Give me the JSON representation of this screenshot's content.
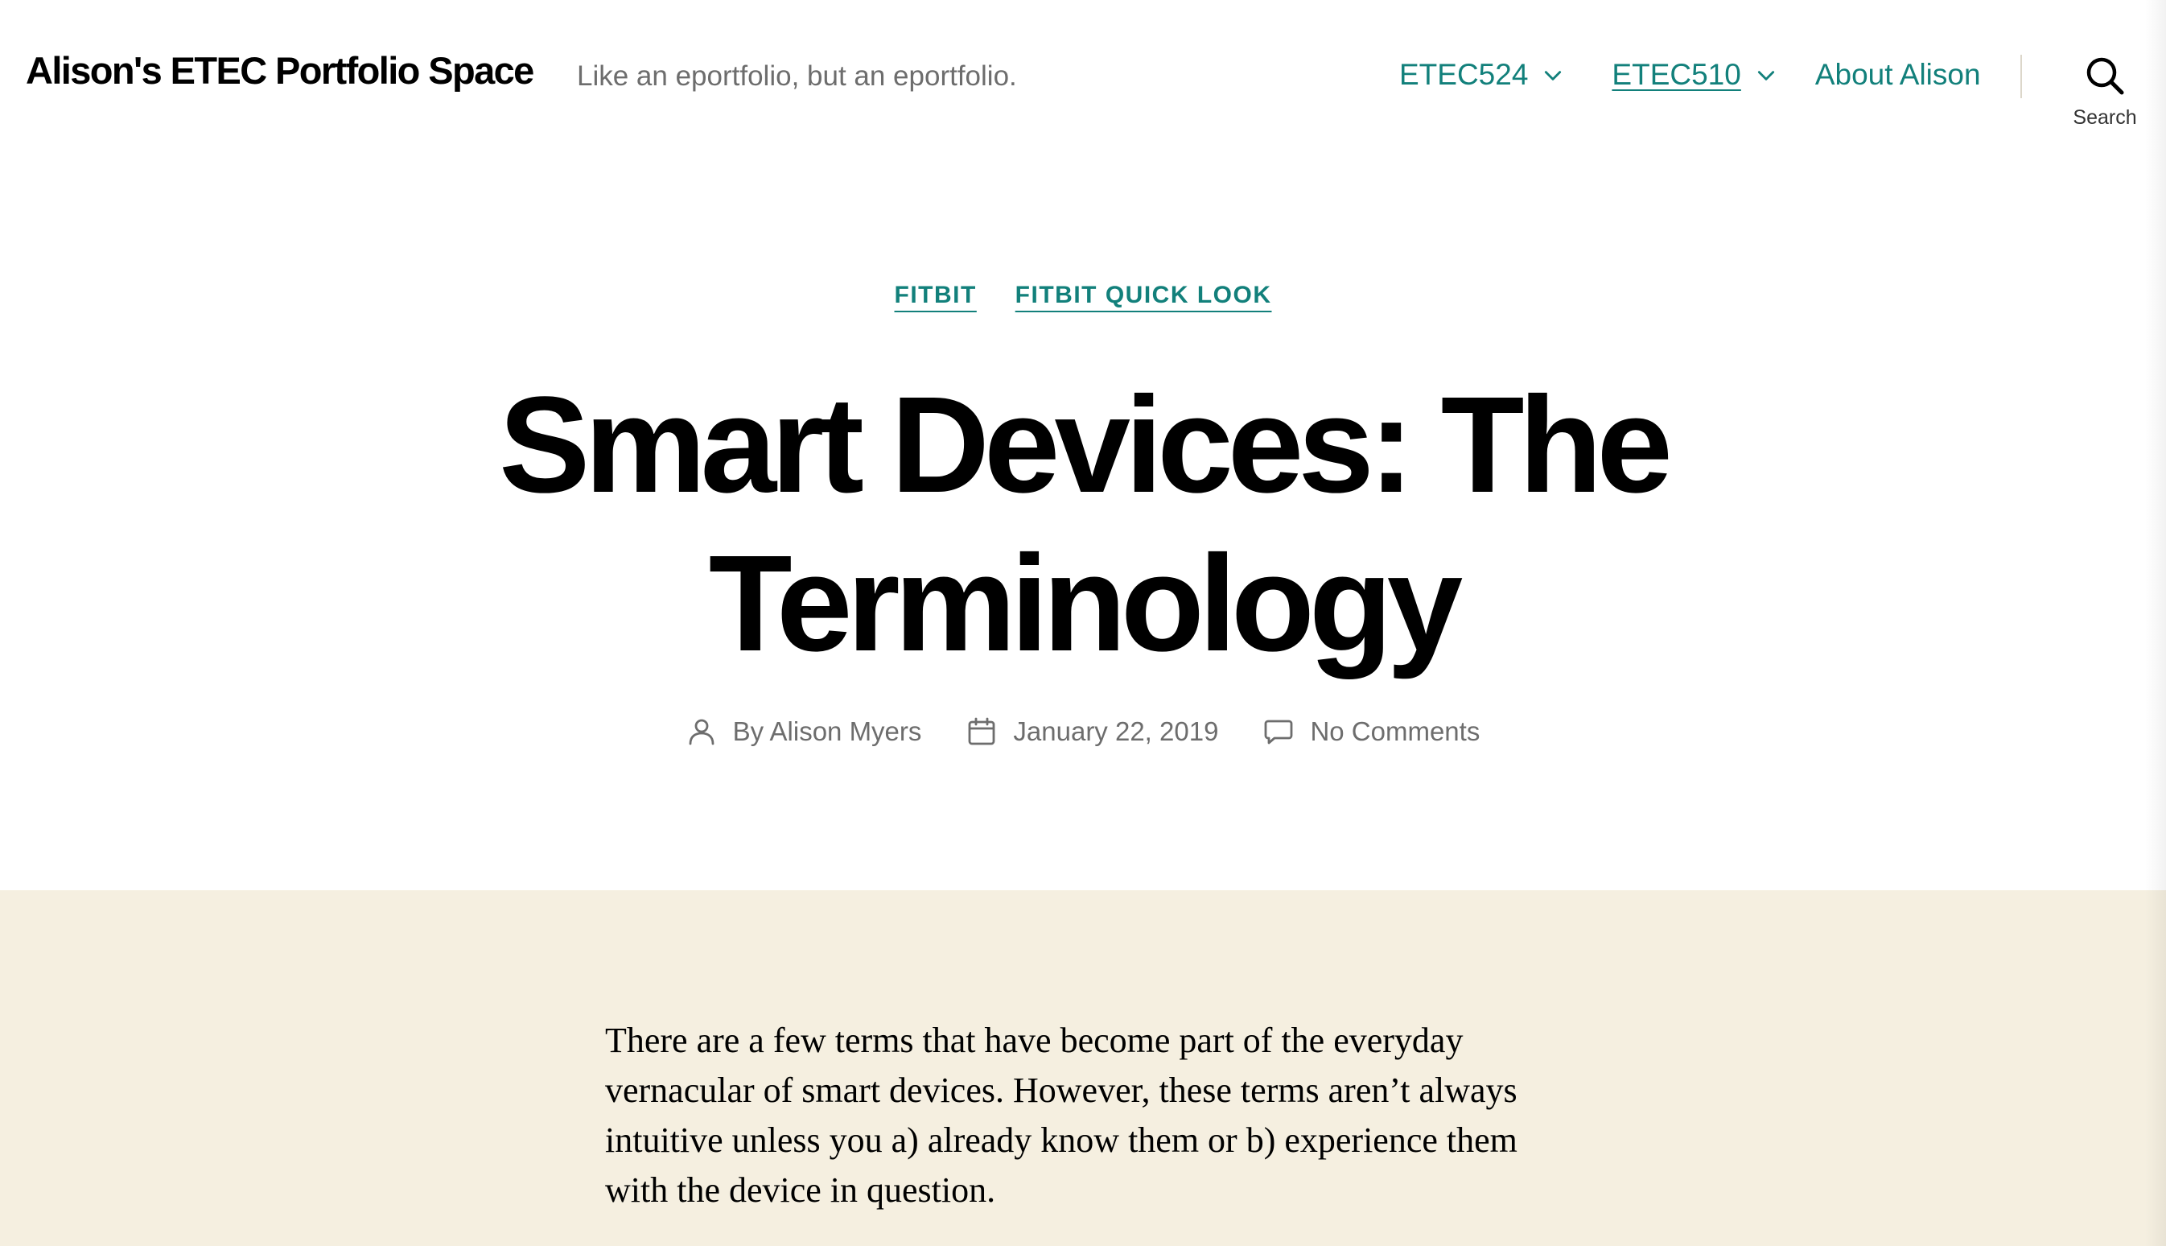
{
  "site": {
    "title": "Alison's ETEC Portfolio Space",
    "tagline": "Like an eportfolio, but an eportfolio."
  },
  "nav": {
    "items": [
      {
        "label": "ETEC524",
        "has_submenu": true
      },
      {
        "label": "ETEC510",
        "has_submenu": true
      },
      {
        "label": "About Alison",
        "has_submenu": false
      }
    ]
  },
  "search": {
    "label": "Search",
    "icon": "search-icon"
  },
  "post": {
    "categories": [
      "FITBIT",
      "FITBIT QUICK LOOK"
    ],
    "title": "Smart Devices: The Terminology",
    "meta": {
      "author": "By Alison Myers",
      "date": "January 22, 2019",
      "comments": "No Comments",
      "author_icon": "person-icon",
      "date_icon": "calendar-icon",
      "comments_icon": "comment-icon"
    },
    "content": {
      "paragraph_1": "There are a few terms that have become part of the everyday vernacular of smart devices. However, these terms aren’t always intuitive unless you a) already know them or b) experience them with the device in question."
    }
  },
  "colors": {
    "accent": "#12807b",
    "content_background": "#f5efe0",
    "meta_text": "#6d6d6d",
    "divider": "#dcd7ca"
  }
}
